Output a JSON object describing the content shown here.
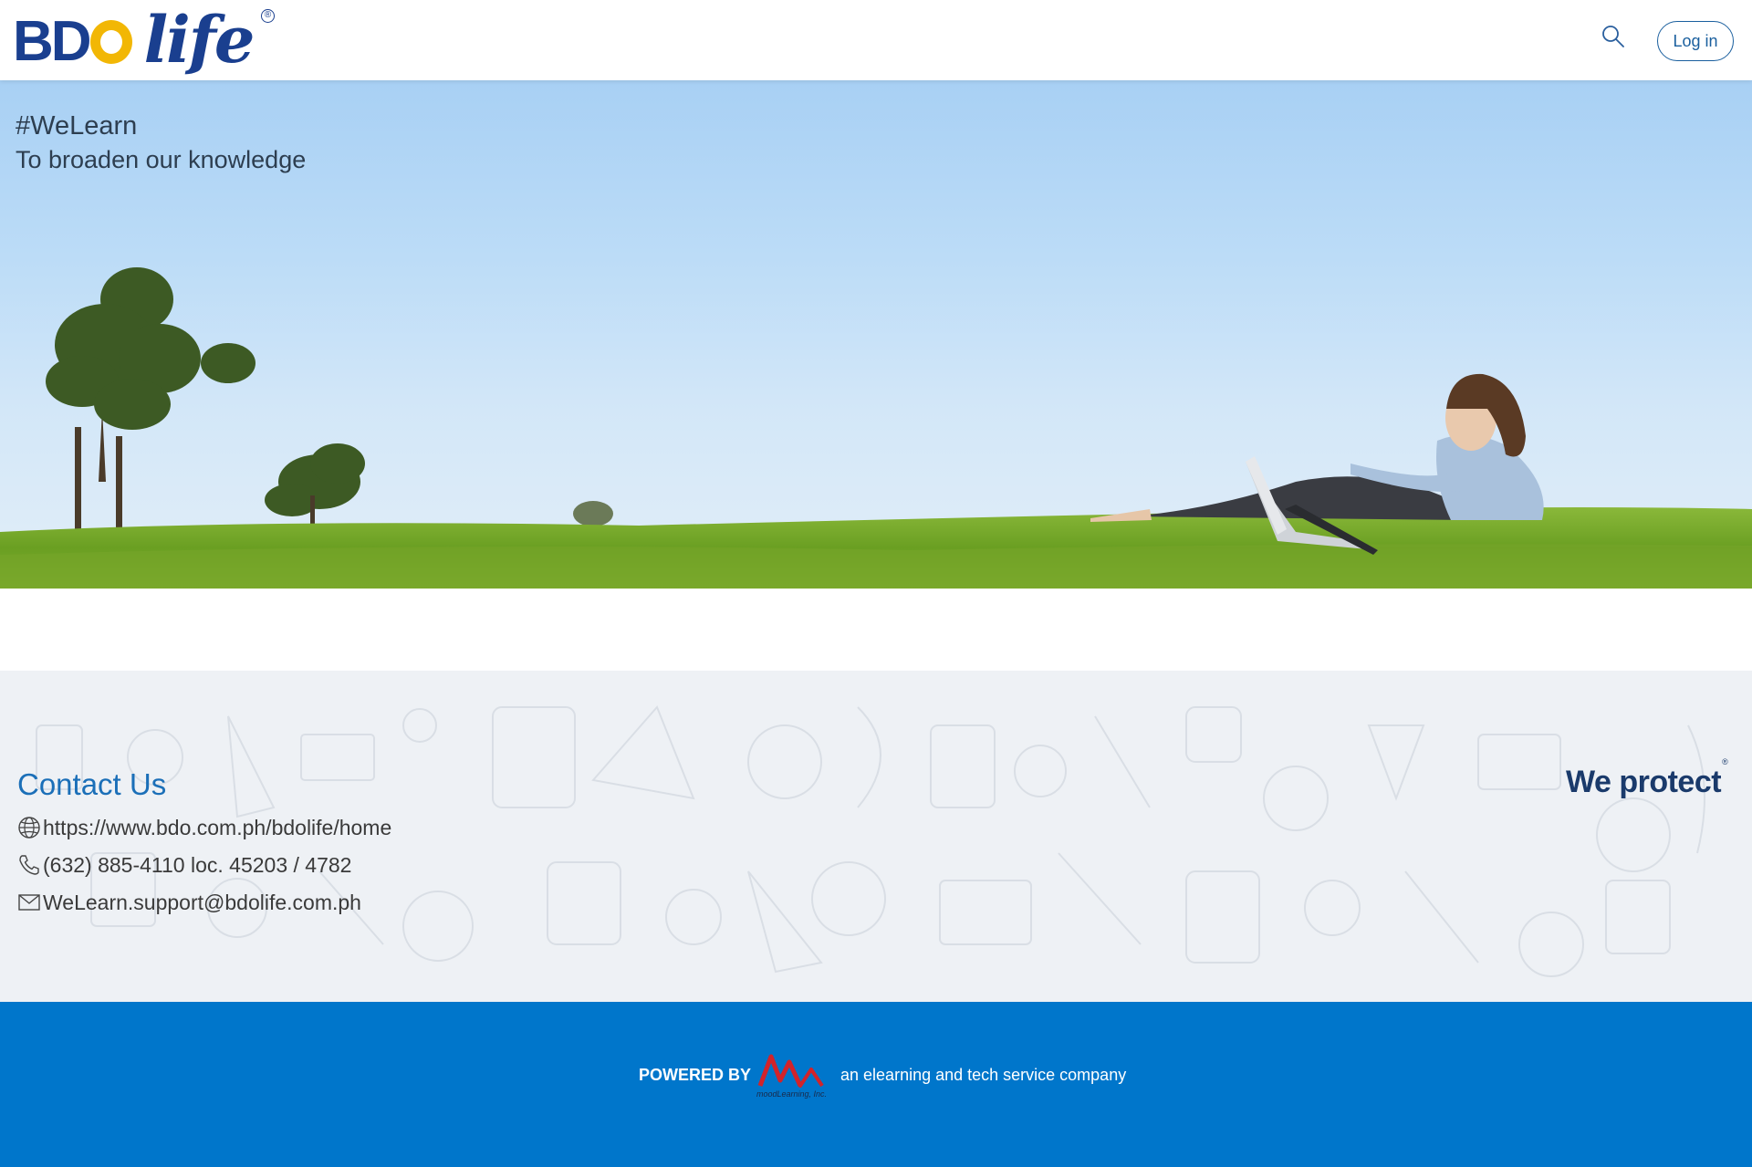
{
  "header": {
    "logo_text_bdo": "BD",
    "logo_text_life": "life",
    "logo_reg": "®",
    "search_icon": "search-icon",
    "login_label": "Log in"
  },
  "hero": {
    "title": "#WeLearn",
    "subtitle": "To broaden our knowledge"
  },
  "contact": {
    "title": "Contact Us",
    "website": "https://www.bdo.com.ph/bdolife/home",
    "phone": "(632) 885-4110 loc. 45203 / 4782",
    "email": "WeLearn.support@bdolife.com.ph",
    "tagline_logo": "We protect",
    "tagline_reg": "®",
    "icons": {
      "website": "globe-icon",
      "phone": "phone-icon",
      "email": "mail-icon"
    }
  },
  "footer": {
    "powered_by": "POWERED BY",
    "company_logo_text": "moodLearning, Inc.",
    "tagline": "an elearning and tech service company"
  },
  "colors": {
    "brand_blue": "#1a3f8f",
    "brand_yellow": "#f2b705",
    "footer_blue": "#0076cb",
    "contact_title_blue": "#1b6fb8"
  }
}
